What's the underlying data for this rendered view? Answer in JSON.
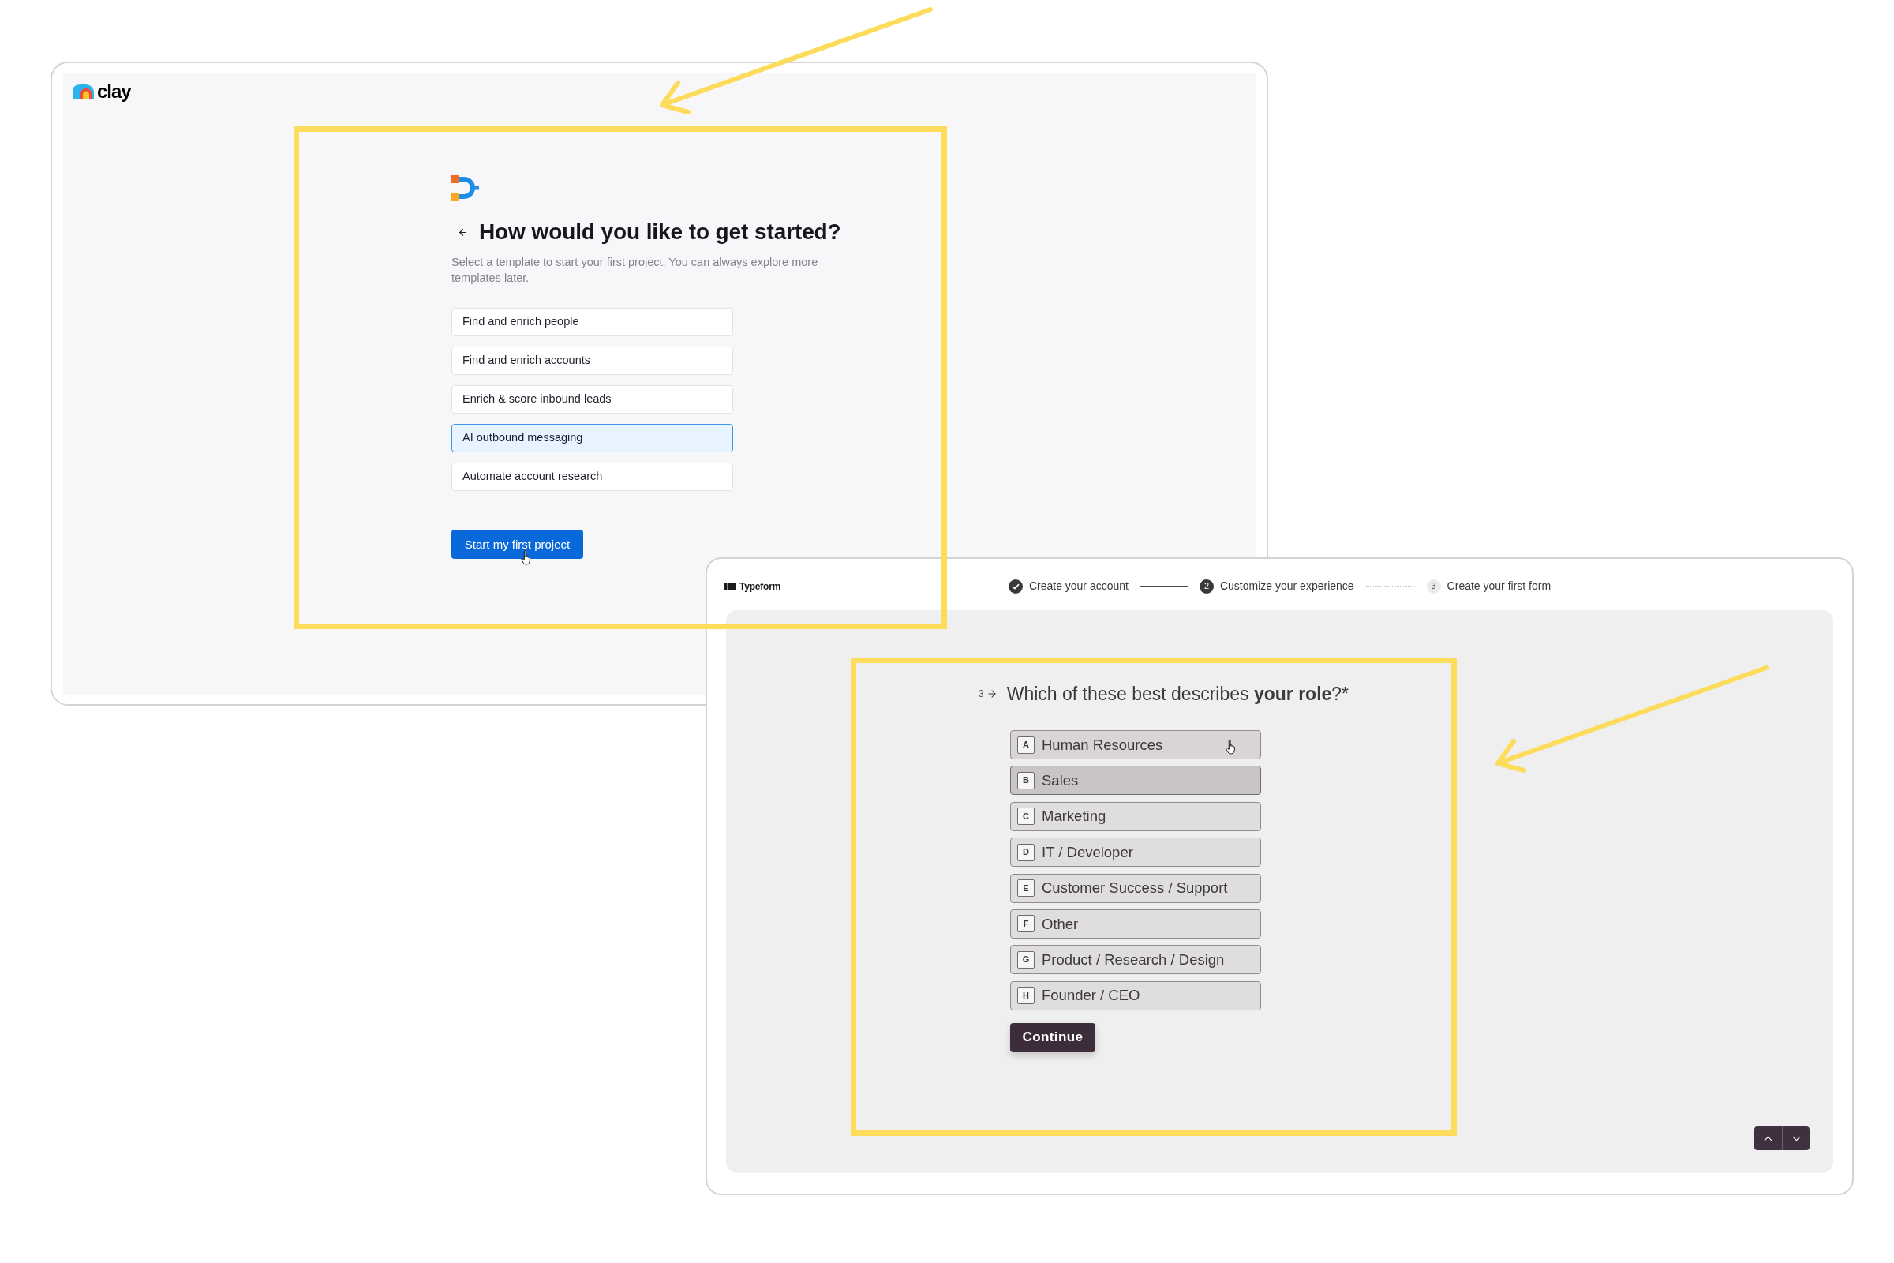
{
  "clay_window": {
    "brand": "clay",
    "heading": "How would you like to get started?",
    "subtitle": "Select a template to start your first project. You can always explore more templates later.",
    "templates": [
      {
        "label": "Find and enrich people",
        "selected": false
      },
      {
        "label": "Find and enrich accounts",
        "selected": false
      },
      {
        "label": "Enrich & score inbound leads",
        "selected": false
      },
      {
        "label": "AI outbound messaging",
        "selected": true
      },
      {
        "label": "Automate account research",
        "selected": false
      }
    ],
    "start_button": {
      "label": "Start my first project",
      "hovered": true
    }
  },
  "typeform_window": {
    "brand": "Typeform",
    "steps": [
      {
        "label": "Create your account",
        "done": true,
        "active": false
      },
      {
        "number": "2",
        "label": "Customize your experience",
        "done": false,
        "active": true
      },
      {
        "number": "3",
        "label": "Create your first form",
        "done": false,
        "active": false
      }
    ],
    "question": {
      "number": "3",
      "text": "Which of these best describes **your role**?*"
    },
    "options": [
      {
        "key": "A",
        "label": "Human Resources",
        "selected": false,
        "hovered": true
      },
      {
        "key": "B",
        "label": "Sales",
        "selected": true,
        "hovered": false
      },
      {
        "key": "C",
        "label": "Marketing",
        "selected": false,
        "hovered": false
      },
      {
        "key": "D",
        "label": "IT / Developer",
        "selected": false,
        "hovered": false
      },
      {
        "key": "E",
        "label": "Customer Success / Support",
        "selected": false,
        "hovered": false
      },
      {
        "key": "F",
        "label": "Other",
        "selected": false,
        "hovered": false
      },
      {
        "key": "G",
        "label": "Product / Research / Design",
        "selected": false,
        "hovered": false
      },
      {
        "key": "H",
        "label": "Founder / CEO",
        "selected": false,
        "hovered": false
      }
    ],
    "continue_button": "Continue"
  }
}
